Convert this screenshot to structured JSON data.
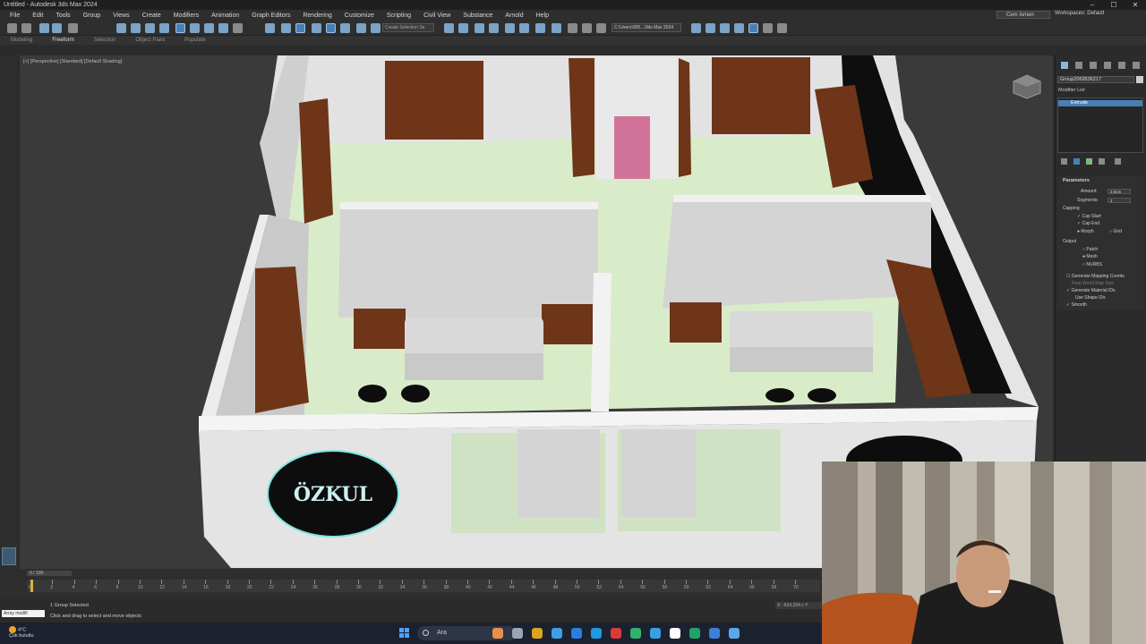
{
  "window": {
    "title": "Untitled - Autodesk 3ds Max 2024",
    "controls": [
      "–",
      "☐",
      "✕"
    ]
  },
  "menu": [
    "File",
    "Edit",
    "Tools",
    "Group",
    "Views",
    "Create",
    "Modifiers",
    "Animation",
    "Graph Editors",
    "Rendering",
    "Customize",
    "Scripting",
    "Civil View",
    "Substance",
    "Arnold",
    "Help"
  ],
  "account": {
    "user": "Cem İsmen",
    "workspace_label": "Workspaces:",
    "workspace": "Default"
  },
  "toolbar": {
    "selection_set": "Create Selection Se",
    "project_path": "C:\\Users\\905...\\3ds Max 2024"
  },
  "ribbon_tabs": [
    "Modeling",
    "Freeform",
    "Selection",
    "Object Paint",
    "Populate"
  ],
  "viewport": {
    "label": "[+] [Perspective] [Standard] [Default Shading]",
    "logo_text": "ÖZKUL",
    "colors": {
      "floor": "#d9ecc9",
      "wall": "#e4e4e4",
      "cabinet": "#6e3518",
      "door": "#d2739a",
      "sofa": "#dadada",
      "black": "#0d0d0d",
      "logo_ring": "#7ee6e6"
    }
  },
  "command_panel": {
    "object_name": "Group2069536217",
    "modifier_list": "Modifier List",
    "stack_selected": "Extrude",
    "rollout_title": "Parameters",
    "amount_label": "Amount:",
    "amount_value": "2,0cm",
    "segments_label": "Segments:",
    "segments_value": "1",
    "capping": "Capping",
    "cap_start": "Cap Start",
    "cap_end": "Cap End",
    "morph": "Morph",
    "grid": "Grid",
    "output": "Output",
    "patch": "Patch",
    "mesh": "Mesh",
    "nurbs": "NURBS",
    "gen_mapping": "Generate Mapping Coords.",
    "real_world": "Real-World Map Size",
    "gen_material": "Generate Material IDs",
    "use_shape": "Use Shape IDs",
    "smooth": "Smooth"
  },
  "timeline": {
    "frame_slider": "0 / 100",
    "ticks": [
      "0",
      "2",
      "4",
      "6",
      "8",
      "10",
      "12",
      "14",
      "16",
      "18",
      "20",
      "22",
      "24",
      "26",
      "28",
      "30",
      "32",
      "34",
      "36",
      "38",
      "40",
      "42",
      "44",
      "46",
      "48",
      "50",
      "52",
      "54",
      "56",
      "58",
      "60",
      "62",
      "64",
      "66",
      "68",
      "70"
    ]
  },
  "status": {
    "maxscript": "Array modifi",
    "selected": "1 Group Selected",
    "prompt": "Click and drag to select and move objects",
    "coords": "X: -634,394 c Y:"
  },
  "taskbar": {
    "temp": "4°C",
    "weather": "Çok bulutlu",
    "search": "Ara",
    "app_colors": [
      "#e8914a",
      "#9aa4b8",
      "#d9a520",
      "#3ba0e8",
      "#2a7ee0",
      "#1e9ae0",
      "#d93a3a",
      "#31b36b",
      "#3aa0e0",
      "#ffffff",
      "#21a366",
      "#3c7fd6",
      "#5aa8e8"
    ]
  }
}
